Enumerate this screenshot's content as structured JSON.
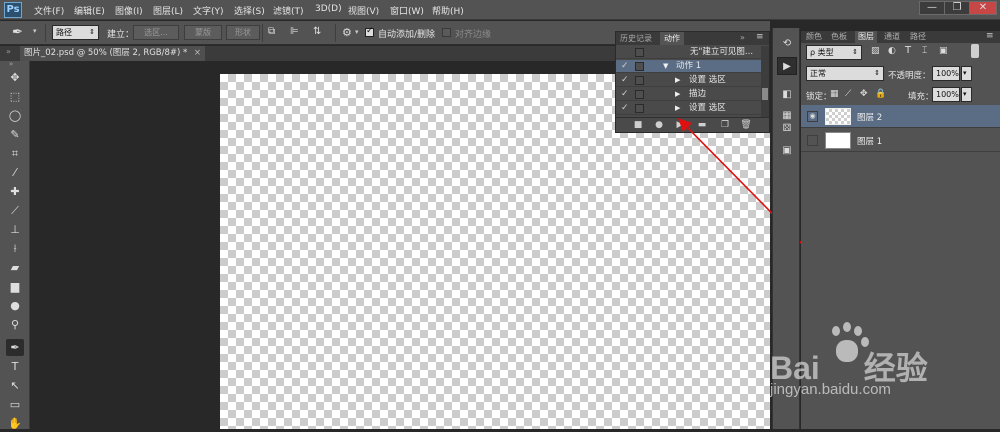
{
  "app": {
    "logo": "Ps"
  },
  "menu": [
    "文件(F)",
    "编辑(E)",
    "图像(I)",
    "图层(L)",
    "文字(Y)",
    "选择(S)",
    "滤镜(T)",
    "3D(D)",
    "视图(V)",
    "窗口(W)",
    "帮助(H)"
  ],
  "window_controls": {
    "minimize": "—",
    "restore": "❐",
    "close": "✕"
  },
  "options_bar": {
    "path_mode": "路径",
    "make_label": "建立：",
    "selection_btn": "选区...",
    "mask_btn": "蒙版",
    "shape_btn": "形状",
    "auto_add_label": "自动添加/删除",
    "align_edges_label": "对齐边缘",
    "auto_add_checked": true
  },
  "document": {
    "tab_title": "图片_02.psd @ 50% (图层 2, RGB/8#) *"
  },
  "actions_panel": {
    "tabs": [
      "历史记录",
      "动作"
    ],
    "active_tab": "动作",
    "rows": [
      {
        "label": "无\"建立可见图...",
        "checked": false,
        "indent": 0,
        "expanded": null,
        "selected": false
      },
      {
        "label": "动作 1",
        "checked": true,
        "indent": 1,
        "expanded": true,
        "selected": true
      },
      {
        "label": "设置 选区",
        "checked": true,
        "indent": 2,
        "expanded": false,
        "selected": false
      },
      {
        "label": "描边",
        "checked": true,
        "indent": 2,
        "expanded": false,
        "selected": false
      },
      {
        "label": "设置 选区",
        "checked": true,
        "indent": 2,
        "expanded": false,
        "selected": false
      }
    ],
    "footer_buttons": [
      "stop-icon",
      "record-icon",
      "play-icon",
      "folder-icon",
      "new-action-icon",
      "trash-icon"
    ]
  },
  "layers_panel": {
    "tabs": [
      "颜色",
      "色板",
      "图层",
      "通道",
      "路径"
    ],
    "active_tab": "图层",
    "filter_label": "ρ 类型",
    "blend_mode": "正常",
    "opacity_label": "不透明度：",
    "opacity_value": "100%",
    "lock_label": "锁定：",
    "fill_label": "填充：",
    "fill_value": "100%",
    "layers": [
      {
        "name": "图层 2",
        "visible": true,
        "selected": true,
        "thumb": "transparent"
      },
      {
        "name": "图层 1",
        "visible": false,
        "selected": false,
        "thumb": "white"
      }
    ]
  },
  "watermark": {
    "brand": "Bai",
    "brand2": "经验",
    "url": "jingyan.baidu.com"
  },
  "colors": {
    "annotation_arrow": "#e01010",
    "selection": "#5b6d85",
    "panel_bg": "#535353"
  }
}
